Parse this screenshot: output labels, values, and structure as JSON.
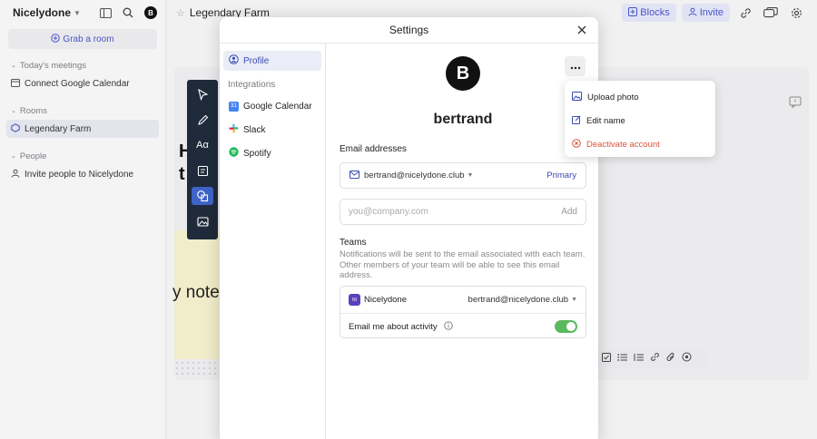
{
  "sidebar": {
    "workspace_name": "Nicelydone",
    "avatar_letter": "B",
    "grab_room": "Grab a room",
    "sections": {
      "meetings": "Today's meetings",
      "rooms": "Rooms",
      "people": "People"
    },
    "connect_calendar": "Connect Google Calendar",
    "room_item": "Legendary Farm",
    "invite_people": "Invite people to Nicelydone"
  },
  "topbar": {
    "room_title": "Legendary Farm",
    "blocks_label": "Blocks",
    "invite_label": "Invite"
  },
  "canvas": {
    "heading_fragment_1": "H",
    "heading_fragment_2": "t",
    "note_fragment": "y note"
  },
  "modal": {
    "title": "Settings",
    "nav": {
      "profile": "Profile",
      "integrations_header": "Integrations",
      "google_calendar": "Google Calendar",
      "slack": "Slack",
      "spotify": "Spotify"
    },
    "profile": {
      "avatar_letter": "B",
      "name": "bertrand",
      "email_label": "Email addresses",
      "email": "bertrand@nicelydone.club",
      "primary_badge": "Primary",
      "add_placeholder": "you@company.com",
      "add_button": "Add",
      "teams_label": "Teams",
      "teams_desc": "Notifications will be sent to the email associated with each team. Other members of your team will be able to see this email address.",
      "team_name": "Nicelydone",
      "team_logo_text": "NI",
      "team_email": "bertrand@nicelydone.club",
      "email_activity_label": "Email me about activity",
      "email_activity_on": true
    }
  },
  "dropdown": {
    "upload_photo": "Upload photo",
    "edit_name": "Edit name",
    "deactivate": "Deactivate account"
  },
  "colors": {
    "accent": "#3b4bb3",
    "danger": "#d9543f",
    "toggle_on": "#5cb85c",
    "toolbar_dark": "#1f2a3a"
  }
}
